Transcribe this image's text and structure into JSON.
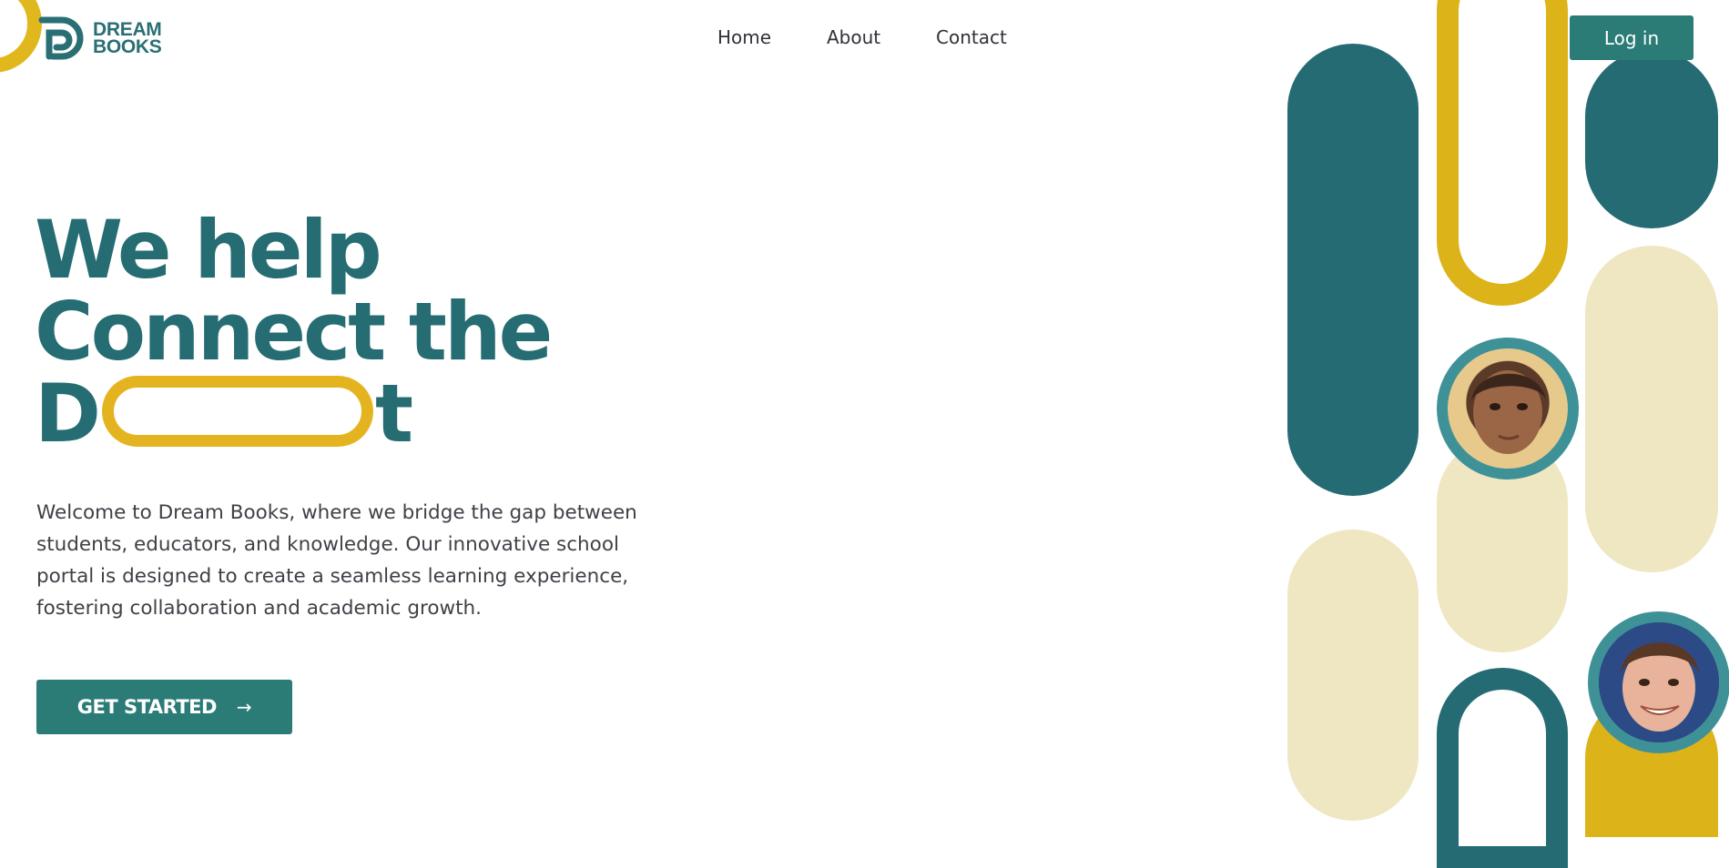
{
  "brand": {
    "line1": "DREAM",
    "line2": "BOOKS",
    "logo_icon": "dream-books-logo-icon"
  },
  "nav": {
    "items": [
      {
        "label": "Home"
      },
      {
        "label": "About"
      },
      {
        "label": "Contact"
      }
    ]
  },
  "header": {
    "login_label": "Log in"
  },
  "hero": {
    "line1": "We help",
    "line2": "Connect the",
    "line3_start": "D",
    "line3_end": "t",
    "description": "Welcome to Dream Books, where we bridge the gap between students, educators, and knowledge. Our innovative school portal is designed to create a seamless learning experience, fostering collaboration and academic growth.",
    "cta_label": "GET STARTED",
    "cta_icon": "arrow-right-icon"
  },
  "colors": {
    "primary_teal": "#2b7b77",
    "heading_teal": "#256d73",
    "mustard": "#dcb41a",
    "cream": "#efe6c2",
    "avatar_ring": "#3f9198"
  }
}
